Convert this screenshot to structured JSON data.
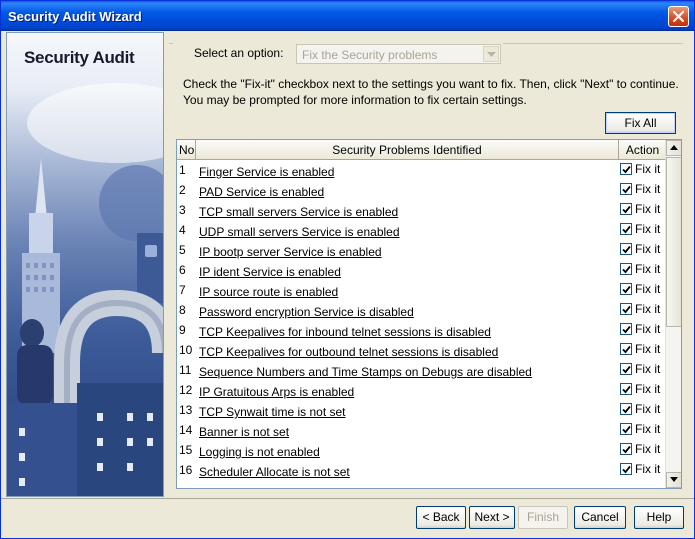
{
  "window": {
    "title": "Security Audit Wizard",
    "close_icon": "close-icon"
  },
  "left_panel": {
    "title": "Security Audit"
  },
  "option": {
    "label": "Select an option:",
    "selected": "Fix the Security problems"
  },
  "instructions": {
    "line1": "Check the \"Fix-it\" checkbox next to the settings you want to fix. Then, click \"Next\" to continue.",
    "line2": "You may be prompted for more information to fix certain settings."
  },
  "fix_all_label": "Fix All",
  "table": {
    "headers": {
      "no": "No",
      "problem": "Security Problems Identified",
      "action": "Action"
    },
    "action_label": "Fix it",
    "rows": [
      {
        "no": "1",
        "problem": "Finger Service is enabled",
        "checked": true
      },
      {
        "no": "2",
        "problem": "PAD Service is enabled",
        "checked": true
      },
      {
        "no": "3",
        "problem": "TCP small servers Service is enabled",
        "checked": true
      },
      {
        "no": "4",
        "problem": "UDP small servers Service is enabled",
        "checked": true
      },
      {
        "no": "5",
        "problem": "IP bootp server Service is enabled",
        "checked": true
      },
      {
        "no": "6",
        "problem": "IP ident Service is enabled",
        "checked": true
      },
      {
        "no": "7",
        "problem": "IP source route is enabled",
        "checked": true
      },
      {
        "no": "8",
        "problem": "Password encryption Service is disabled",
        "checked": true
      },
      {
        "no": "9",
        "problem": "TCP Keepalives for inbound telnet sessions is disabled",
        "checked": true
      },
      {
        "no": "10",
        "problem": "TCP Keepalives for outbound telnet sessions is disabled",
        "checked": true
      },
      {
        "no": "11",
        "problem": "Sequence Numbers and Time Stamps on Debugs are disabled",
        "checked": true
      },
      {
        "no": "12",
        "problem": "IP Gratuitous Arps is enabled",
        "checked": true
      },
      {
        "no": "13",
        "problem": "TCP Synwait time is not set",
        "checked": true
      },
      {
        "no": "14",
        "problem": "Banner is not set",
        "checked": true
      },
      {
        "no": "15",
        "problem": "Logging is not enabled",
        "checked": true
      },
      {
        "no": "16",
        "problem": "Scheduler Allocate is not set",
        "checked": true
      }
    ]
  },
  "buttons": {
    "back": "< Back",
    "next": "Next >",
    "finish": "Finish",
    "cancel": "Cancel",
    "help": "Help"
  }
}
